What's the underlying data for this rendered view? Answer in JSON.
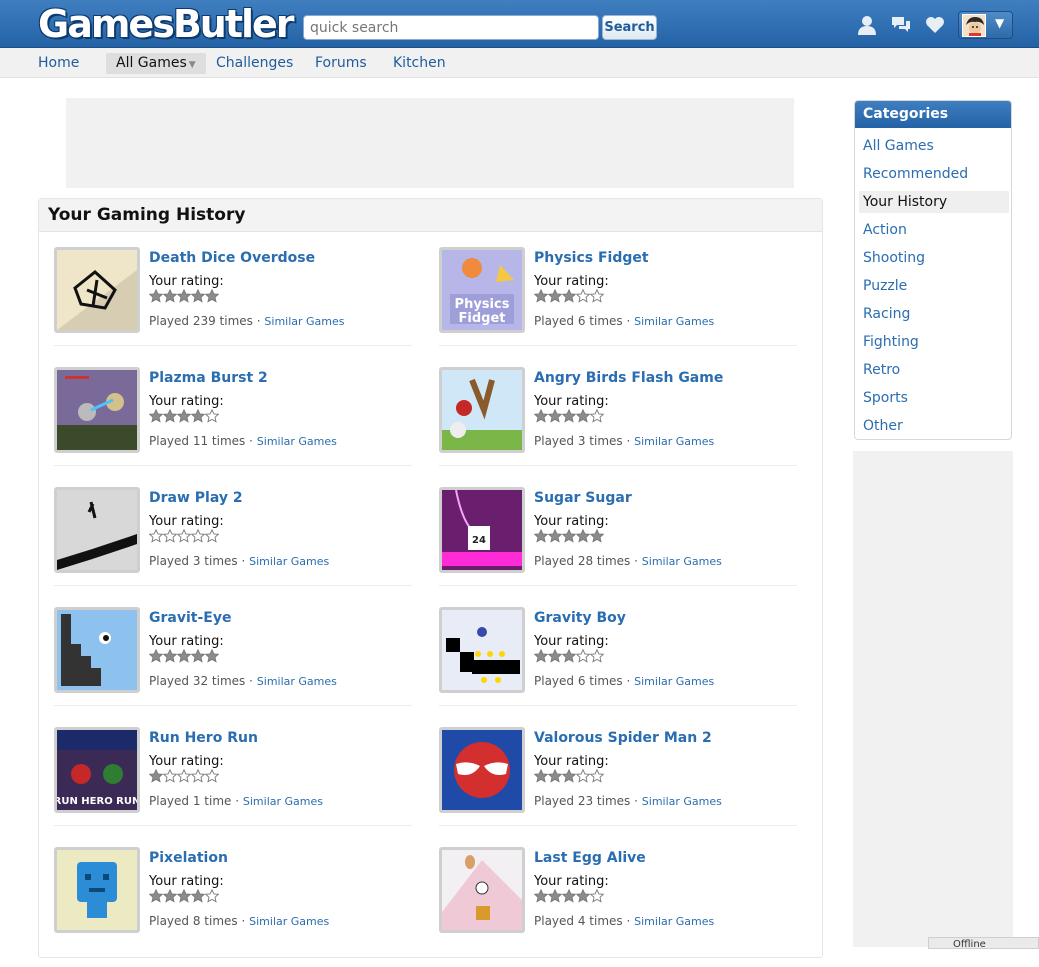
{
  "header": {
    "logo_text": "GamesButler",
    "search_placeholder": "quick search",
    "search_button": "Search",
    "icons": [
      "user-icon",
      "chat-icon",
      "heart-icon"
    ],
    "caret": "▼"
  },
  "nav": {
    "items": [
      "Home",
      "All Games",
      "Challenges",
      "Forums",
      "Kitchen"
    ],
    "active": "All Games",
    "active_caret": "▼"
  },
  "history": {
    "title": "Your Gaming History",
    "rating_label": "Your rating:",
    "similar_label": "Similar Games",
    "separator": "·",
    "games": [
      {
        "name": "Death Dice Overdose",
        "played": "Played 239 times",
        "rating": 5
      },
      {
        "name": "Physics Fidget",
        "played": "Played 6 times",
        "rating": 3
      },
      {
        "name": "Plazma Burst 2",
        "played": "Played 11 times",
        "rating": 4
      },
      {
        "name": "Angry Birds Flash Game",
        "played": "Played 3 times",
        "rating": 4
      },
      {
        "name": "Draw Play 2",
        "played": "Played 3 times",
        "rating": 0
      },
      {
        "name": "Sugar Sugar",
        "played": "Played 28 times",
        "rating": 5
      },
      {
        "name": "Gravit-Eye",
        "played": "Played 32 times",
        "rating": 5
      },
      {
        "name": "Gravity Boy",
        "played": "Played 6 times",
        "rating": 3
      },
      {
        "name": "Run Hero Run",
        "played": "Played 1 time",
        "rating": 1
      },
      {
        "name": "Valorous Spider Man 2",
        "played": "Played 23 times",
        "rating": 3
      },
      {
        "name": "Pixelation",
        "played": "Played 8 times",
        "rating": 4
      },
      {
        "name": "Last Egg Alive",
        "played": "Played 4 times",
        "rating": 4
      }
    ]
  },
  "categories": {
    "title": "Categories",
    "items": [
      "All Games",
      "Recommended",
      "Your History",
      "Action",
      "Shooting",
      "Puzzle",
      "Racing",
      "Fighting",
      "Retro",
      "Sports",
      "Other"
    ],
    "active": "Your History"
  },
  "chat": {
    "status": "Offline"
  },
  "thumb_text": {
    "physics": "Physics",
    "fidget": "Fidget",
    "sugar_cup": "24",
    "run_hero": "RUN HERO RUN"
  },
  "colors": {
    "header_blue": "#2462a6",
    "link_blue": "#2a6db0",
    "star_filled": "#8c8c8c",
    "star_empty": "#ffffff"
  }
}
